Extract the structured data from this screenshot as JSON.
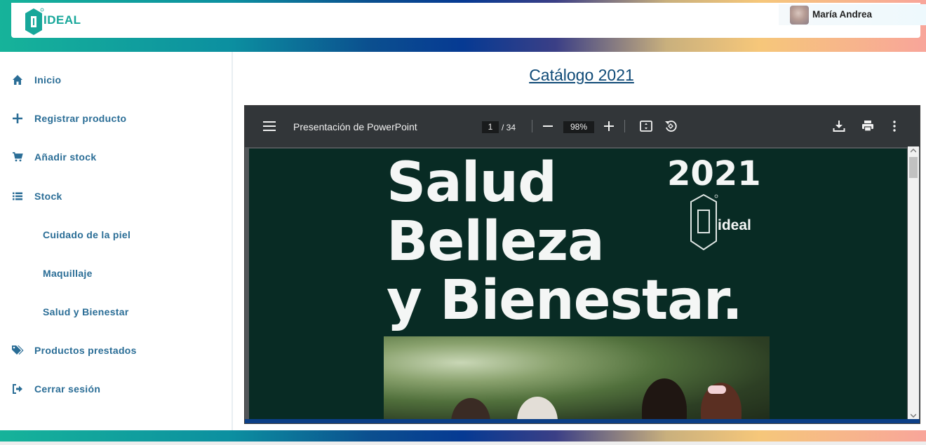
{
  "brand": {
    "logo_text": "IDEAL"
  },
  "user": {
    "name": "María Andrea"
  },
  "sidebar": {
    "items": [
      {
        "label": "Inicio",
        "icon": "home-icon"
      },
      {
        "label": "Registrar producto",
        "icon": "plus-icon"
      },
      {
        "label": "Añadir stock",
        "icon": "cart-icon"
      },
      {
        "label": "Stock",
        "icon": "list-icon"
      },
      {
        "label": "Cuidado de la piel",
        "icon": ""
      },
      {
        "label": "Maquillaje",
        "icon": ""
      },
      {
        "label": "Salud y Bienestar",
        "icon": ""
      },
      {
        "label": "Productos prestados",
        "icon": "tags-icon"
      },
      {
        "label": "Cerrar sesión",
        "icon": "logout-icon"
      }
    ]
  },
  "main": {
    "title": "Catálogo 2021"
  },
  "pdf_viewer": {
    "document_title": "Presentación de PowerPoint",
    "current_page": "1",
    "total_pages": "/ 34",
    "zoom": "98%",
    "cover": {
      "line1": "Salud",
      "line2": "Belleza",
      "line3": "y Bienestar.",
      "year": "2021",
      "brand": "ideal"
    }
  },
  "colors": {
    "accent_teal": "#16b39a",
    "nav_text": "#2a6d96",
    "title_text": "#0f4a77",
    "viewer_toolbar": "#323639",
    "cover_bg": "#082b24"
  }
}
